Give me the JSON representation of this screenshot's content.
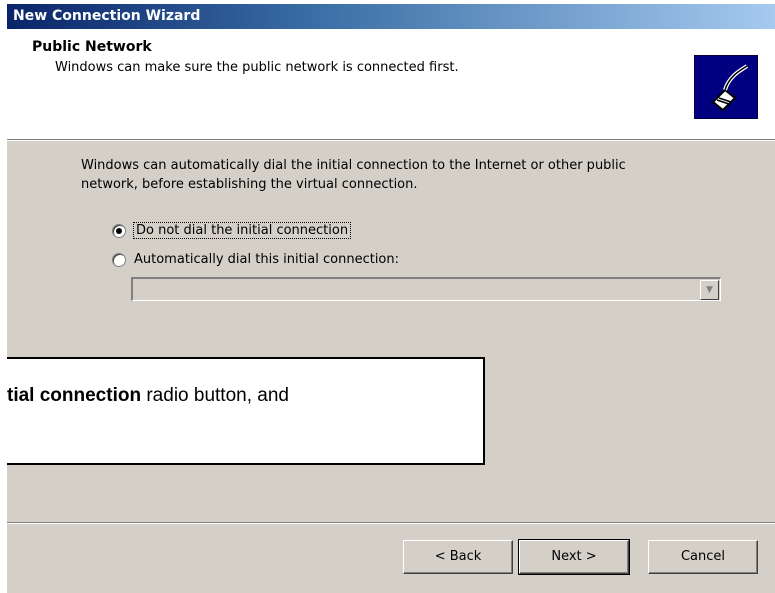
{
  "window": {
    "title": "New Connection Wizard"
  },
  "header": {
    "title": "Public Network",
    "subtitle": "Windows can make sure the public network is connected first.",
    "icon": "network-cable-icon"
  },
  "content": {
    "description": "Windows can automatically dial the initial connection to the Internet or other public network, before establishing the virtual connection.",
    "options": [
      {
        "label": "Do not dial the initial connection",
        "checked": true
      },
      {
        "label": "Automatically dial this initial connection:",
        "checked": false
      }
    ],
    "combo_value": ""
  },
  "callout": {
    "text_bold": "tial connection",
    "text_rest": " radio button, and"
  },
  "buttons": {
    "back": "< Back",
    "next": "Next >",
    "cancel": "Cancel"
  }
}
